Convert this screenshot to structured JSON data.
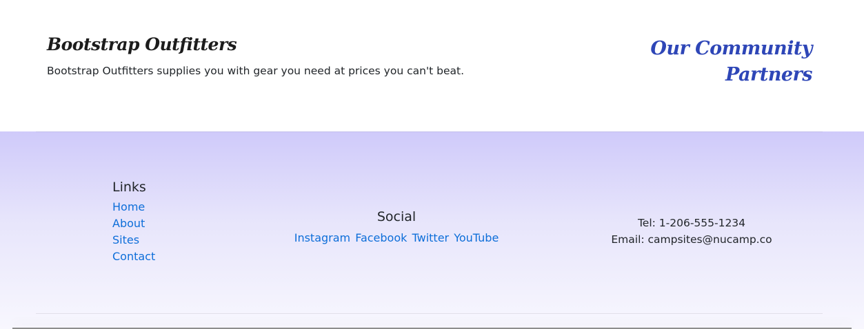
{
  "intro": {
    "brand_title": "Bootstrap Outfitters",
    "tagline": "Bootstrap Outfitters supplies you with gear you need at prices you can't beat.",
    "partners_title": "Our Community Partners"
  },
  "footer": {
    "links": {
      "heading": "Links",
      "items": [
        {
          "label": "Home"
        },
        {
          "label": "About"
        },
        {
          "label": "Sites"
        },
        {
          "label": "Contact"
        }
      ]
    },
    "social": {
      "heading": "Social",
      "items": [
        {
          "label": "Instagram"
        },
        {
          "label": "Facebook"
        },
        {
          "label": "Twitter"
        },
        {
          "label": "YouTube"
        }
      ]
    },
    "contact": {
      "tel": "Tel: 1-206-555-1234",
      "email": "Email: campsites@nucamp.co"
    }
  },
  "colors": {
    "partners_title": "#2e46b7",
    "link": "#0d6ed9",
    "footer_gradient_top": "#cfcafa",
    "footer_gradient_bottom": "#f8f7fe"
  }
}
